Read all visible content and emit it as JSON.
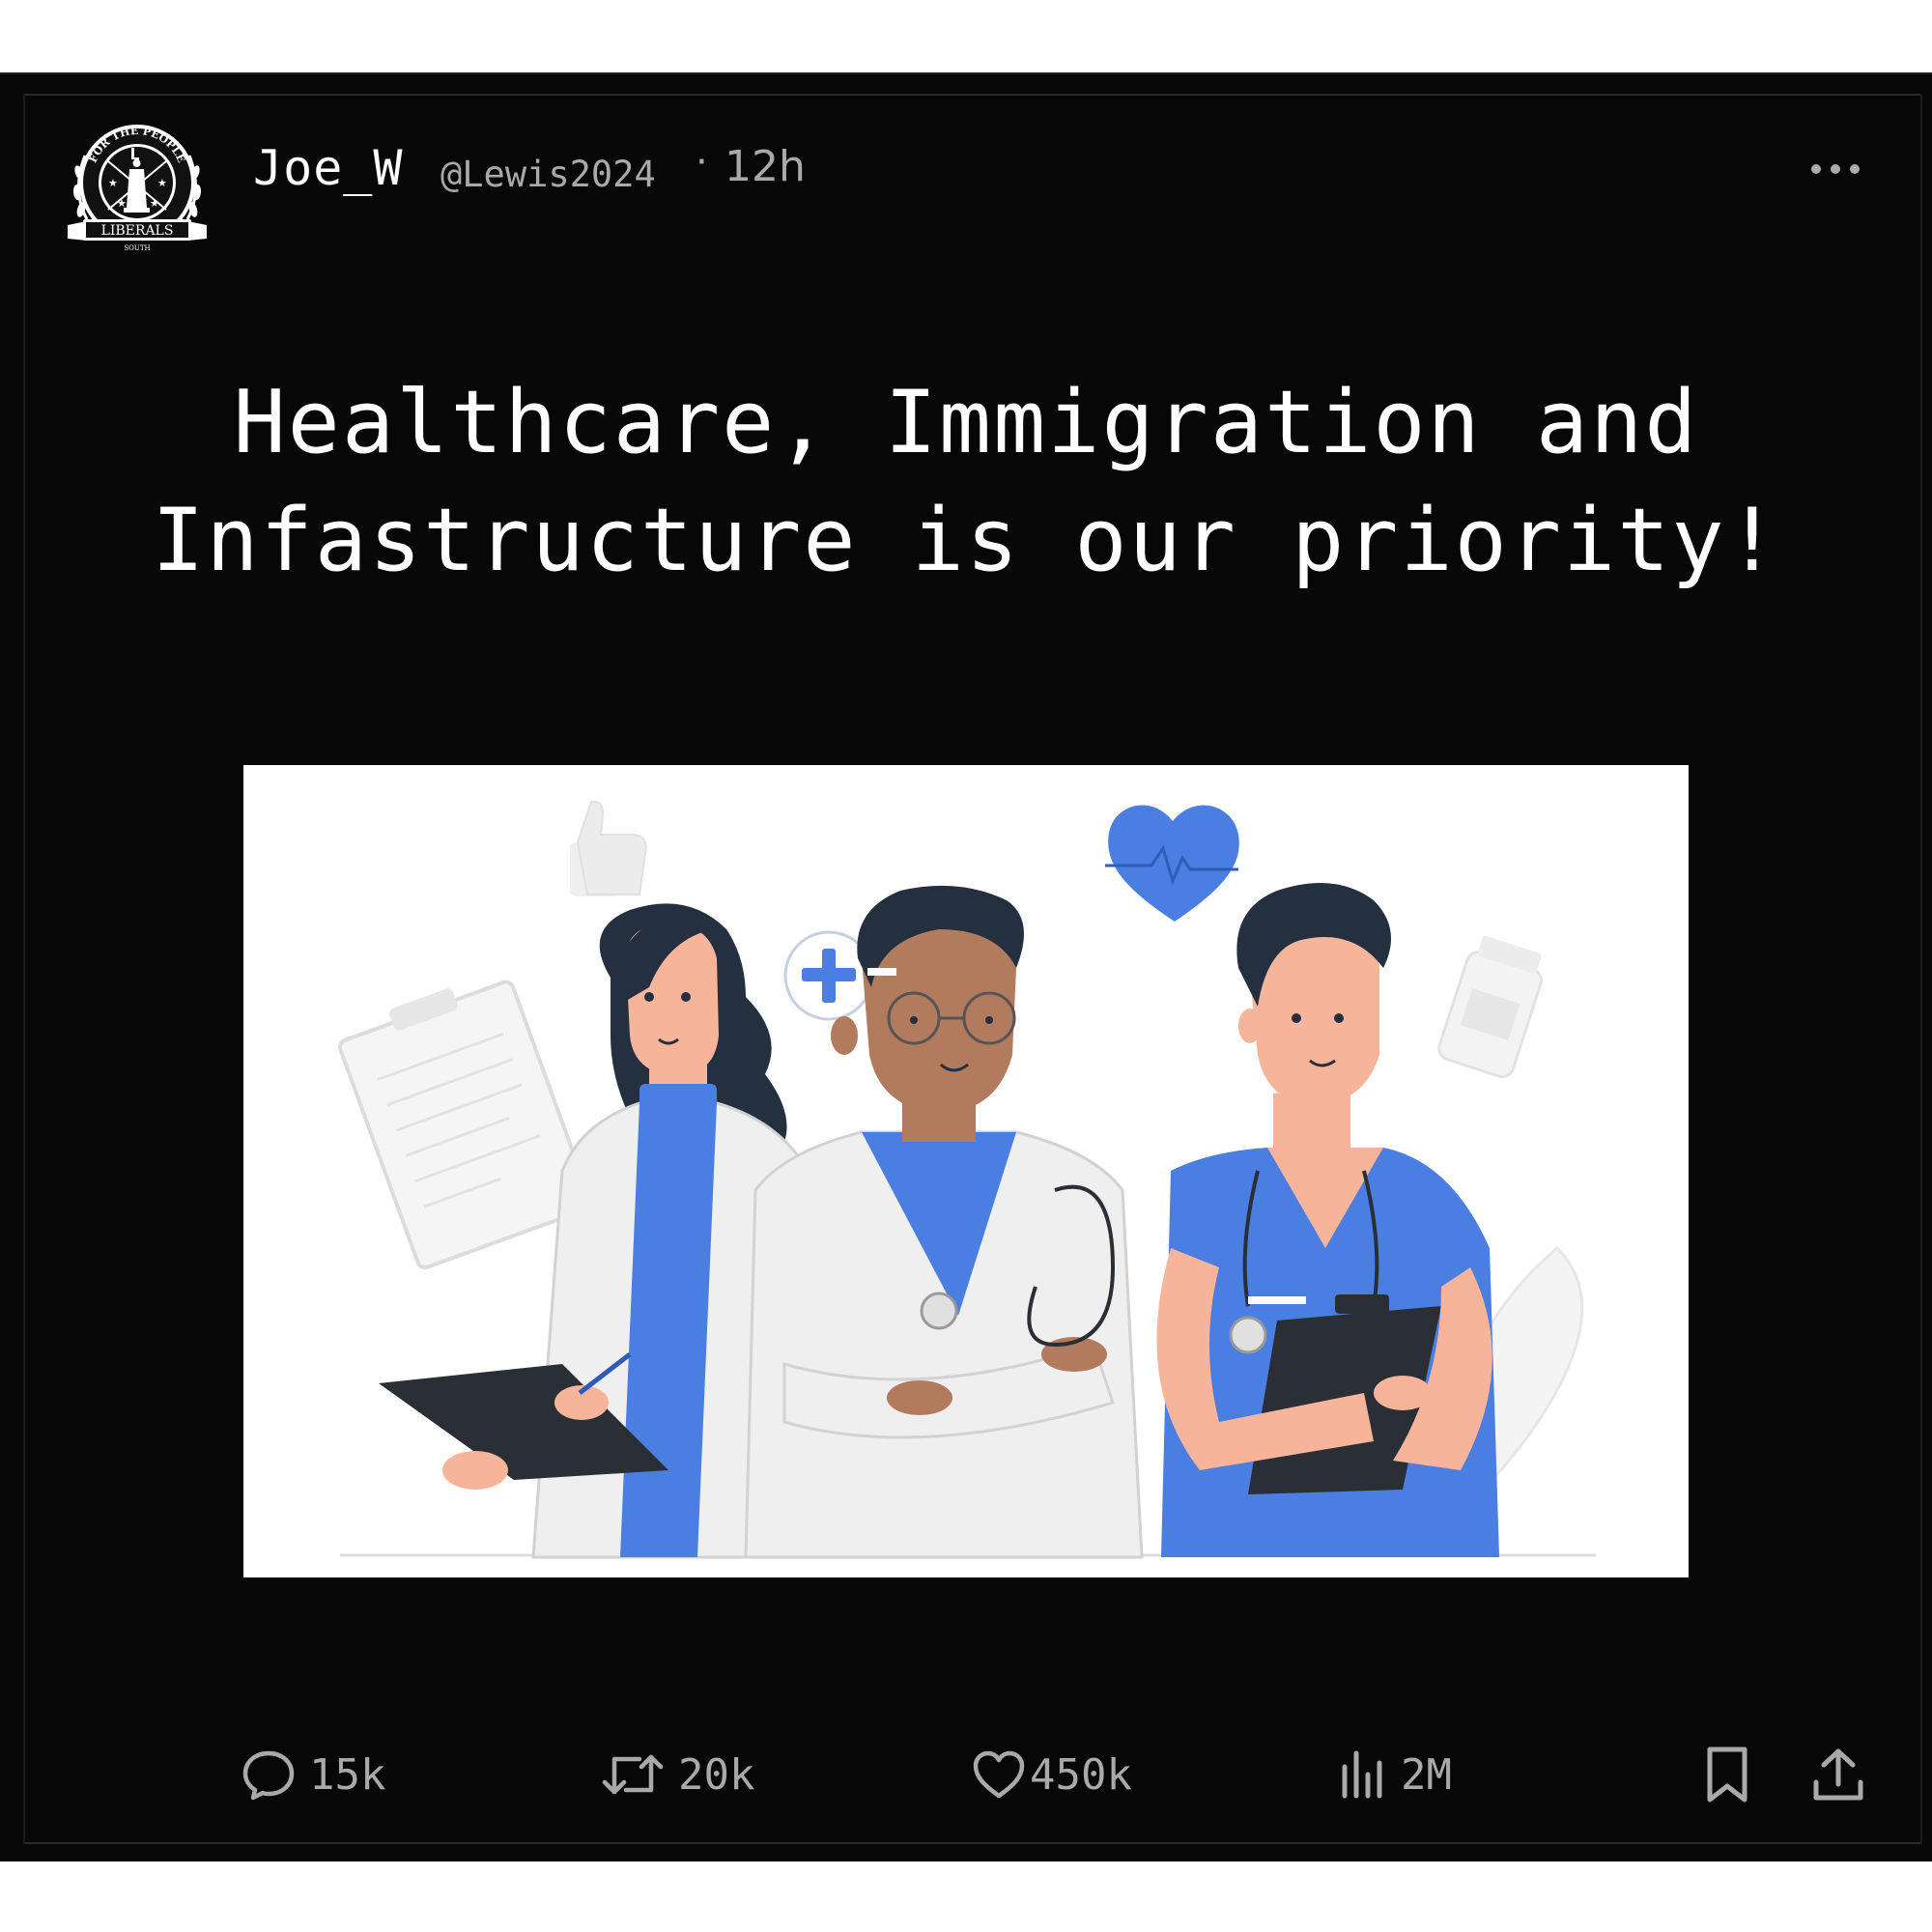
{
  "post": {
    "avatar": {
      "icon": "party-seal-avatar-icon",
      "seal_top_text": "FOR THE PEOPLE",
      "seal_banner_text": "LIBERALS",
      "seal_bottom_text": "SOUTH"
    },
    "author": {
      "display_name": "Joe_W",
      "handle": "@Lewis2024"
    },
    "separator": "·",
    "time_ago": "12h",
    "more_icon": "more-horizontal-icon",
    "headline_lines": [
      "Healthcare, Immigration and",
      "Infastructure is our priority!"
    ],
    "image": {
      "description": "illustration-three-medical-staff",
      "icons": [
        "thumbs-up-icon",
        "plus-badge-icon",
        "heart-pulse-icon",
        "clipboard-icon",
        "pill-bottle-icon"
      ]
    },
    "actions": {
      "reply": {
        "icon": "reply-bubble-icon",
        "count": "15k"
      },
      "repost": {
        "icon": "repost-icon",
        "count": "20k"
      },
      "like": {
        "icon": "heart-icon",
        "count": "450k"
      },
      "views": {
        "icon": "views-chart-icon",
        "count": "2M"
      },
      "bookmark": {
        "icon": "bookmark-icon"
      },
      "share": {
        "icon": "share-upload-icon"
      }
    },
    "colors": {
      "background": "#070707",
      "text": "#ffffff",
      "muted": "#a9a9a9",
      "accent_blue": "#4a7ee0",
      "skin": "#f6b59a",
      "dark_hair": "#243040"
    }
  }
}
